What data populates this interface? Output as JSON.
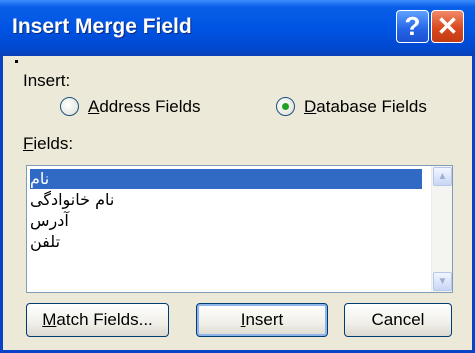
{
  "window": {
    "title": "Insert Merge Field",
    "help_glyph": "?",
    "close_glyph": "✕"
  },
  "insert": {
    "label": "Insert:",
    "options": [
      {
        "label_prefix": "",
        "label_accel": "A",
        "label_rest": "ddress Fields",
        "checked": false
      },
      {
        "label_prefix": "",
        "label_accel": "D",
        "label_rest": "atabase Fields",
        "checked": true
      }
    ]
  },
  "fields": {
    "label_accel": "F",
    "label_rest": "ields:",
    "items": [
      {
        "text": "نام",
        "selected": true
      },
      {
        "text": "نام خانوادگی",
        "selected": false
      },
      {
        "text": "آدرس",
        "selected": false
      },
      {
        "text": "تلفن",
        "selected": false
      }
    ]
  },
  "buttons": {
    "match_accel": "M",
    "match_rest": "atch Fields...",
    "insert_accel": "I",
    "insert_rest": "nsert",
    "cancel": "Cancel"
  },
  "icons": {
    "scroll_up": "up-arrow-icon",
    "scroll_down": "down-arrow-icon"
  },
  "colors": {
    "title_bar": "#0054e3",
    "selection": "#316ac5",
    "dialog_bg": "#ece9d8",
    "close": "#d9491f"
  }
}
